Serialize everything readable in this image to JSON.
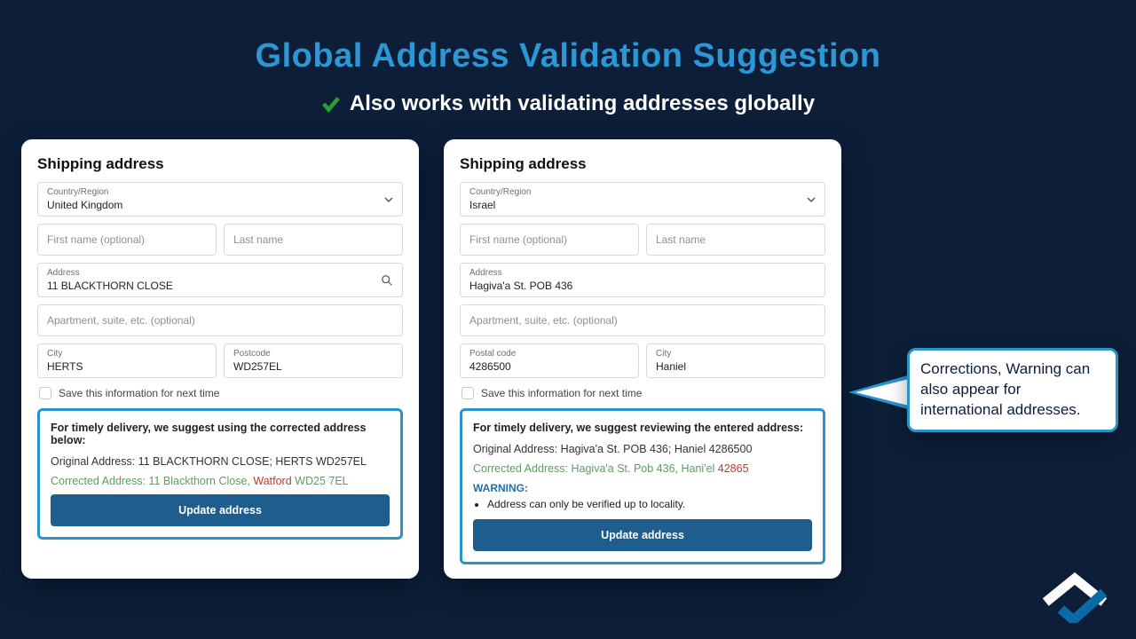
{
  "title": "Global Address Validation Suggestion",
  "subtitle": "Also works with validating addresses globally",
  "callout": "Corrections, Warning can also appear for international addresses.",
  "shared": {
    "shipping_heading": "Shipping address",
    "country_label": "Country/Region",
    "first_name_ph": "First name (optional)",
    "last_name_ph": "Last name",
    "address_label": "Address",
    "apt_ph": "Apartment, suite, etc. (optional)",
    "save_label": "Save this information for next time",
    "update_btn": "Update address",
    "orig_label": "Original Address:",
    "corr_label": "Corrected Address:"
  },
  "uk": {
    "country": "United Kingdom",
    "address": "11 BLACKTHORN CLOSE",
    "city_label": "City",
    "city": "HERTS",
    "postcode_label": "Postcode",
    "postcode": "WD257EL",
    "suggest_lead": "For timely delivery, we suggest using the corrected address below:",
    "orig_value": "11 BLACKTHORN CLOSE; HERTS WD257EL",
    "corr_main": "11 Blackthorn Close, ",
    "corr_added": "Watford",
    "corr_tail": " WD25 7EL"
  },
  "il": {
    "country": "Israel",
    "address": "Hagiva'a St. POB 436",
    "postal_label": "Postal code",
    "postal": "4286500",
    "city_label": "City",
    "city": "Haniel",
    "suggest_lead": "For timely delivery, we suggest reviewing the entered address:",
    "orig_value": "Hagiva'a St. POB 436; Haniel 4286500",
    "corr_main": "Hagiva'a St. Pob 436, Hani'el ",
    "corr_added": "42865",
    "warn_heading": "WARNING:",
    "warn_item": "Address can only be verified up to locality."
  }
}
